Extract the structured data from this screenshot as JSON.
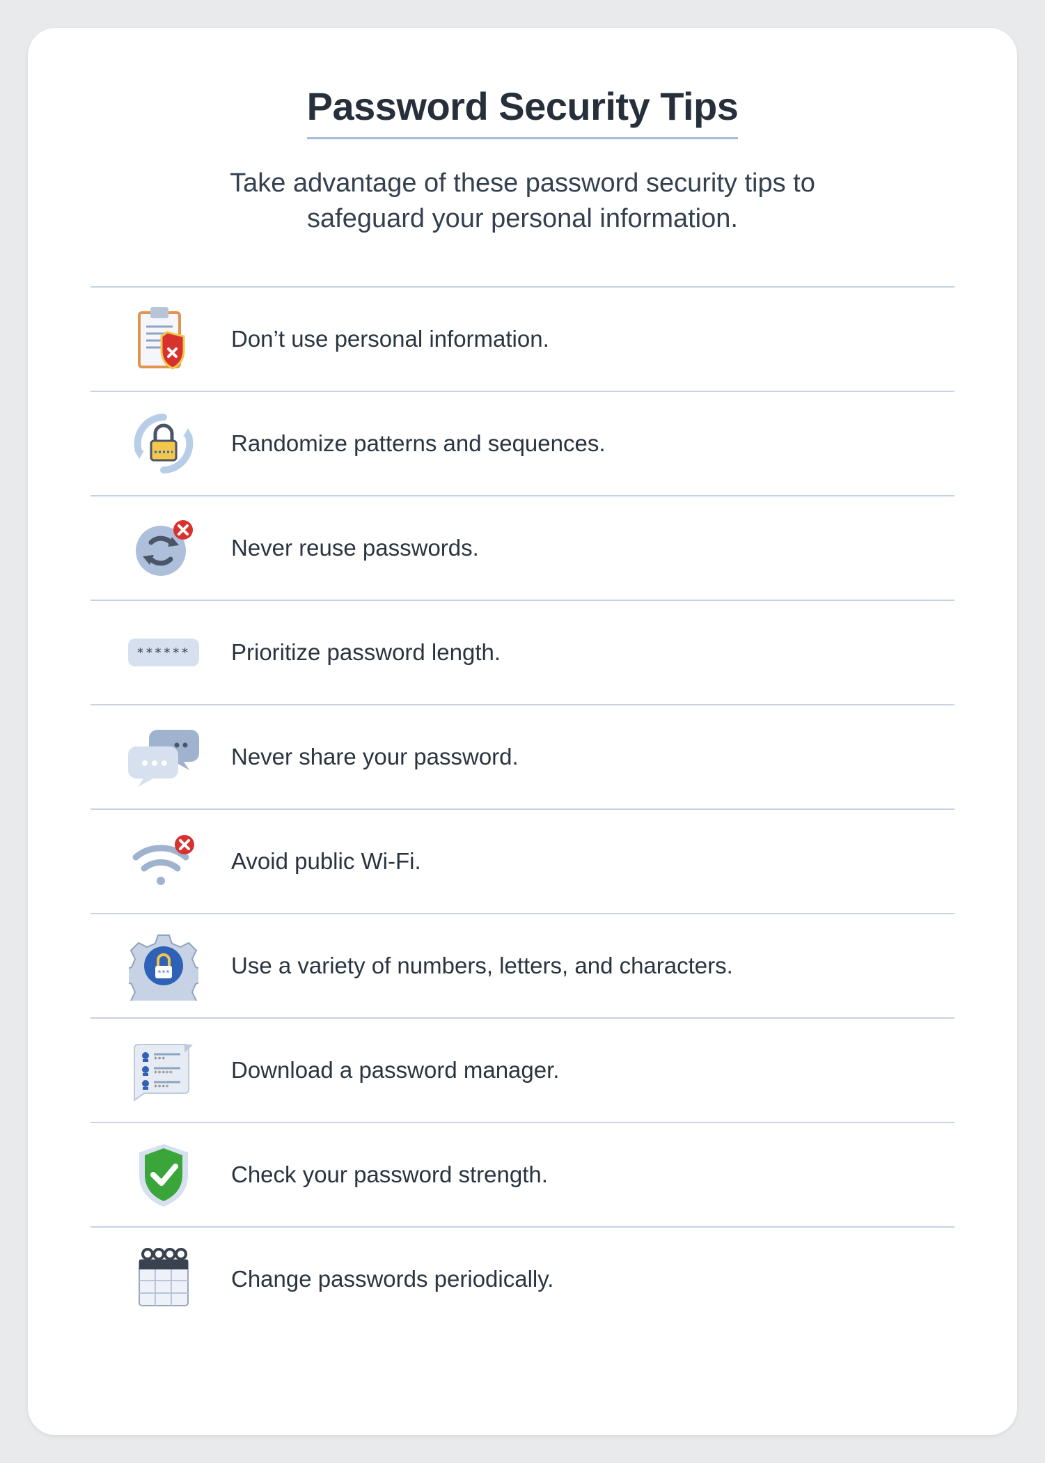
{
  "header": {
    "title": "Password Security Tips",
    "subtitle": "Take advantage of these password security tips to safeguard your personal information."
  },
  "tips": [
    {
      "icon": "clipboard-shield-icon",
      "text": "Don’t use personal information."
    },
    {
      "icon": "lock-refresh-icon",
      "text": "Randomize patterns and sequences."
    },
    {
      "icon": "recycle-x-icon",
      "text": "Never reuse passwords."
    },
    {
      "icon": "password-length-icon",
      "text": "Prioritize password length."
    },
    {
      "icon": "chat-bubbles-icon",
      "text": "Never share your password."
    },
    {
      "icon": "wifi-x-icon",
      "text": "Avoid public Wi-Fi."
    },
    {
      "icon": "gear-lock-icon",
      "text": "Use a variety of numbers, letters, and characters."
    },
    {
      "icon": "password-manager-icon",
      "text": "Download a password manager."
    },
    {
      "icon": "shield-check-icon",
      "text": "Check your password strength."
    },
    {
      "icon": "calendar-icon",
      "text": "Change passwords periodically."
    }
  ],
  "colors": {
    "divider": "#c7d3e2",
    "accent_blue": "#2f62b6",
    "accent_red": "#d8322f",
    "accent_green": "#3aa63a",
    "soft_blue": "#cfdaea"
  }
}
